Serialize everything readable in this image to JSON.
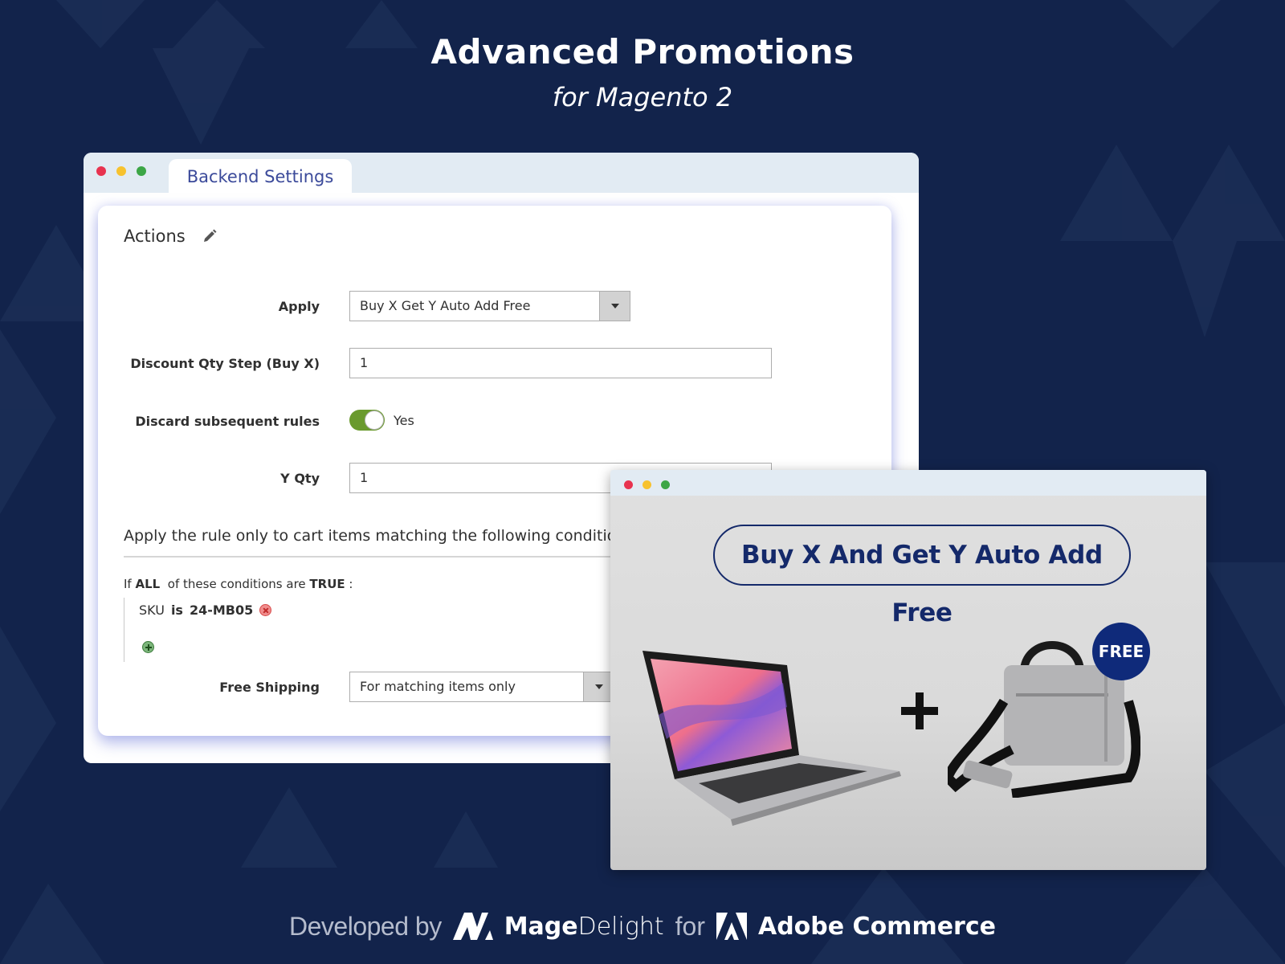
{
  "hero": {
    "title": "Advanced Promotions",
    "subtitle": "for Magento 2"
  },
  "backend_window": {
    "tab_label": "Backend Settings",
    "section_title": "Actions",
    "fields": {
      "apply": {
        "label": "Apply",
        "value": "Buy X Get Y Auto Add Free"
      },
      "discount_qty_step": {
        "label": "Discount Qty Step (Buy X)",
        "value": "1"
      },
      "discard_subsequent": {
        "label": "Discard subsequent rules",
        "state_label": "Yes",
        "enabled": true
      },
      "y_qty": {
        "label": "Y Qty",
        "value": "1"
      },
      "free_shipping": {
        "label": "Free Shipping",
        "value": "For matching items only"
      }
    },
    "conditions": {
      "heading": "Apply the rule only to cart items matching the following conditions",
      "if_prefix": "If",
      "aggregator": "ALL",
      "middle": "of these conditions are",
      "value": "TRUE",
      "suffix": ":",
      "rule": {
        "attribute": "SKU",
        "operator": "is",
        "value": "24-MB05"
      }
    }
  },
  "front_window": {
    "promo_title": "Buy X And Get Y Auto Add Free",
    "badge": "FREE",
    "products": [
      "laptop",
      "laptop-bag"
    ]
  },
  "footer": {
    "developed_by": "Developed by",
    "brand_bold": "Mage",
    "brand_light": "Delight",
    "for": "for",
    "platform": "Adobe Commerce"
  },
  "colors": {
    "background": "#12234b",
    "accent_navy": "#14296a",
    "tab_text": "#3b4a9a",
    "toggle_on": "#6a9a2e",
    "badge": "#0f2a7a"
  }
}
